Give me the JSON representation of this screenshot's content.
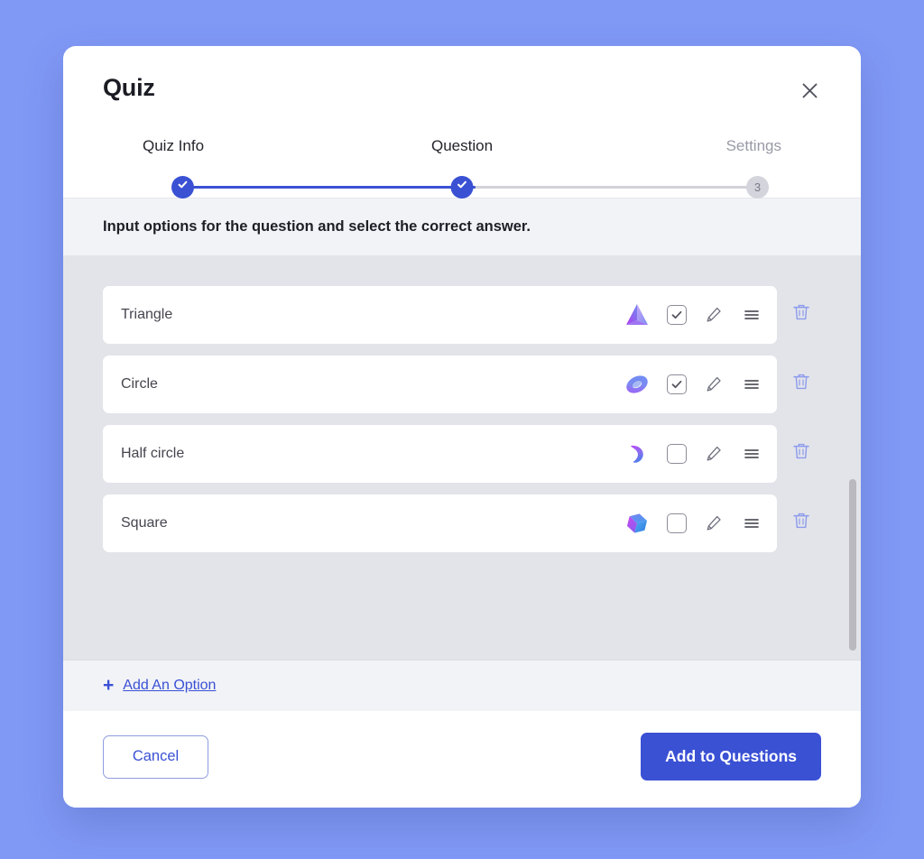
{
  "theme": {
    "page_background": "#8099F5",
    "accent": "#3A51D4",
    "panel_background": "#E3E4EA",
    "strip_background": "#F2F3F7",
    "card_background": "#FFFFFF",
    "muted_text": "#9A9AA8"
  },
  "dialog": {
    "title": "Quiz",
    "close_icon": "close-icon"
  },
  "stepper": {
    "steps": [
      {
        "label": "Quiz Info",
        "state": "done",
        "marker": "check-icon"
      },
      {
        "label": "Question",
        "state": "done",
        "marker": "check-icon"
      },
      {
        "label": "Settings",
        "state": "todo",
        "marker": "3"
      }
    ]
  },
  "instruction": {
    "text": "Input options for the question and select the correct answer."
  },
  "options": {
    "items": [
      {
        "label": "Triangle",
        "shape_icon": "triangle-3d-icon",
        "checked": true,
        "edit_icon": "pencil-icon",
        "drag_icon": "drag-handle-icon",
        "delete_icon": "trash-icon"
      },
      {
        "label": "Circle",
        "shape_icon": "torus-3d-icon",
        "checked": true,
        "edit_icon": "pencil-icon",
        "drag_icon": "drag-handle-icon",
        "delete_icon": "trash-icon"
      },
      {
        "label": "Half circle",
        "shape_icon": "half-circle-3d-icon",
        "checked": false,
        "edit_icon": "pencil-icon",
        "drag_icon": "drag-handle-icon",
        "delete_icon": "trash-icon"
      },
      {
        "label": "Square",
        "shape_icon": "cube-3d-icon",
        "checked": false,
        "edit_icon": "pencil-icon",
        "drag_icon": "drag-handle-icon",
        "delete_icon": "trash-icon"
      }
    ]
  },
  "add_option": {
    "label": "Add An Option",
    "icon": "plus-icon"
  },
  "footer": {
    "cancel_label": "Cancel",
    "submit_label": "Add to Questions"
  }
}
